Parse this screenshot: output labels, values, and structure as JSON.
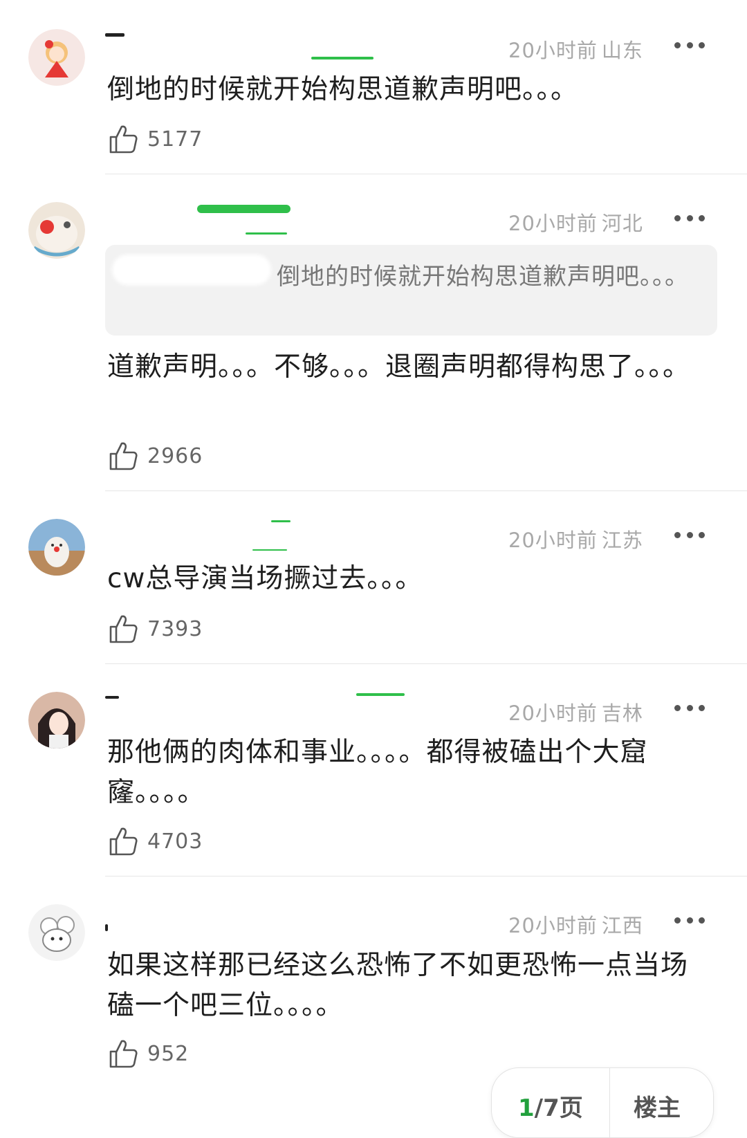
{
  "comments": [
    {
      "time": "20小时前",
      "location": "山东",
      "text": "倒地的时候就开始构思道歉声明吧。。。",
      "likes": "5177"
    },
    {
      "time": "20小时前",
      "location": "河北",
      "quote": "倒地的时候就开始构思道歉声明吧。。。",
      "text": "道歉声明。。。不够。。。退圈声明都得构思了。。。",
      "likes": "2966"
    },
    {
      "time": "20小时前",
      "location": "江苏",
      "text": "cw总导演当场撅过去。。。",
      "likes": "7393"
    },
    {
      "time": "20小时前",
      "location": "吉林",
      "text": "那他俩的肉体和事业。。。。都得被磕出个大窟窿。。。。",
      "likes": "4703"
    },
    {
      "time": "20小时前",
      "location": "江西",
      "text": "如果这样那已经这么恐怖了不如更恐怖一点当场磕一个吧三位。。。。",
      "likes": "952"
    }
  ],
  "pager": {
    "current": "1",
    "total": "/7页",
    "op_label": "楼主"
  },
  "icons": {
    "like": "thumbs-up-icon",
    "more": "more-dots-icon"
  },
  "colors": {
    "accent": "#21a03c",
    "meta": "#a8a8a8"
  }
}
